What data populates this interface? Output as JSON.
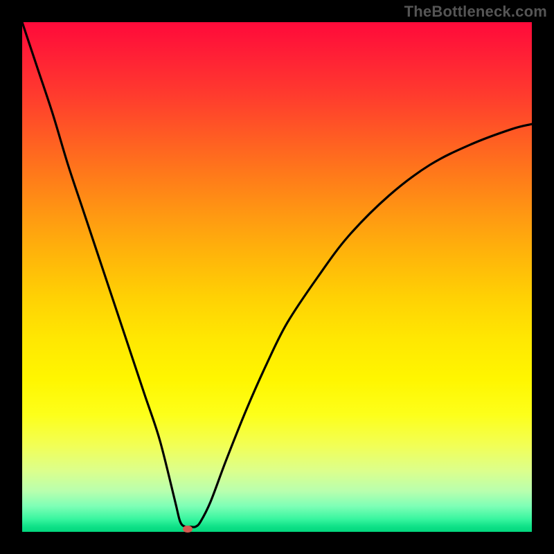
{
  "watermark": "TheBottleneck.com",
  "chart_data": {
    "type": "line",
    "title": "",
    "xlabel": "",
    "ylabel": "",
    "xlim": [
      0,
      100
    ],
    "ylim": [
      0,
      100
    ],
    "grid": false,
    "legend": false,
    "background_gradient": {
      "direction": "vertical",
      "stops": [
        {
          "pos": 0.0,
          "color": "#ff0a3a"
        },
        {
          "pos": 0.3,
          "color": "#ff7a1a"
        },
        {
          "pos": 0.6,
          "color": "#ffe702"
        },
        {
          "pos": 0.85,
          "color": "#ecff7a"
        },
        {
          "pos": 1.0,
          "color": "#02d77e"
        }
      ]
    },
    "series": [
      {
        "name": "bottleneck-curve",
        "color": "#000000",
        "x": [
          0,
          3,
          6,
          9,
          12,
          15,
          18,
          21,
          24,
          27,
          30,
          31,
          32,
          33,
          34,
          35,
          37,
          40,
          44,
          48,
          52,
          58,
          64,
          72,
          80,
          88,
          96,
          100
        ],
        "y": [
          100,
          91,
          82,
          72,
          63,
          54,
          45,
          36,
          27,
          18,
          6,
          2,
          1,
          1,
          1,
          2,
          6,
          14,
          24,
          33,
          41,
          50,
          58,
          66,
          72,
          76,
          79,
          80
        ]
      }
    ],
    "markers": [
      {
        "name": "optimal-point",
        "x": 32.5,
        "y": 0.5,
        "color": "#d45a50"
      }
    ]
  }
}
